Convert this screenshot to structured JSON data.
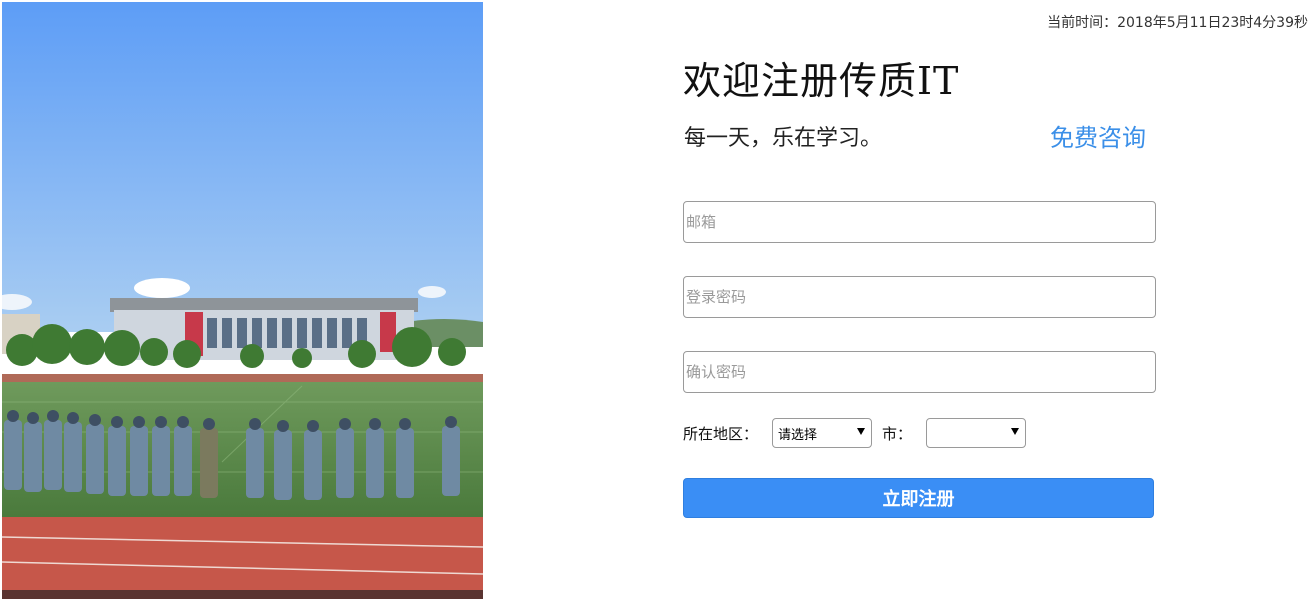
{
  "header": {
    "time_text": "当前时间：2018年5月11日23时4分39秒"
  },
  "hero": {
    "image_icon": "campus-photo"
  },
  "main": {
    "title": "欢迎注册传质IT",
    "subtitle": "每一天，乐在学习。",
    "consult_link": "免费咨询"
  },
  "form": {
    "email_placeholder": "邮箱",
    "email_value": "",
    "password_placeholder": "登录密码",
    "password_value": "",
    "confirm_placeholder": "确认密码",
    "confirm_value": "",
    "region_label": "所在地区：",
    "province_selected": "请选择",
    "city_label": "市：",
    "city_selected": "",
    "submit_label": "立即注册"
  },
  "colors": {
    "accent": "#3a8ef5",
    "link": "#3b8fe8",
    "border": "#9a9a9a"
  }
}
